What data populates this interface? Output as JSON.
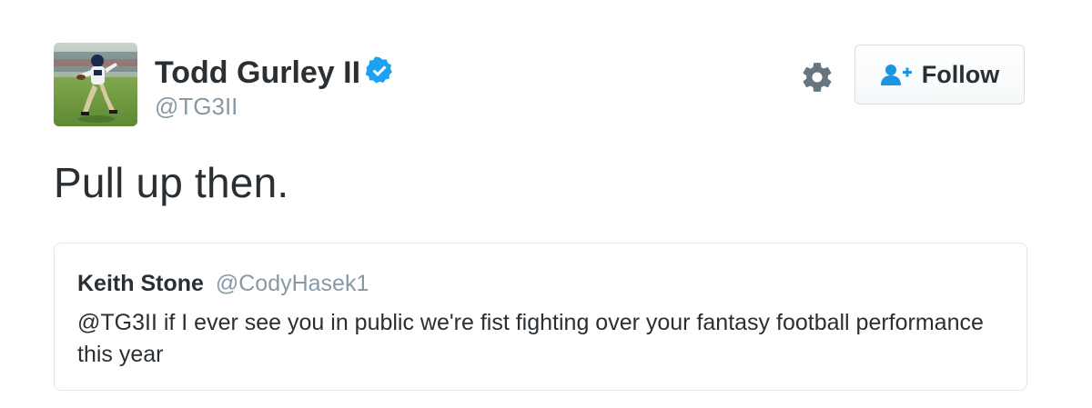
{
  "tweet": {
    "author": {
      "display_name": "Todd Gurley II",
      "handle": "@TG3II",
      "verified": true
    },
    "text": "Pull up then.",
    "actions": {
      "settings_icon": "gear-icon",
      "follow_label": "Follow",
      "follow_icon": "add-user-icon"
    },
    "quoted": {
      "display_name": "Keith Stone",
      "handle": "@CodyHasek1",
      "text": "@TG3II if I ever see you in public we're fist fighting over your fantasy football performance this year"
    }
  },
  "colors": {
    "text": "#292f33",
    "secondary": "#8899a6",
    "verified_blue": "#1da1f2",
    "follow_icon_blue": "#1b95e0",
    "border": "#e1e8ed"
  }
}
